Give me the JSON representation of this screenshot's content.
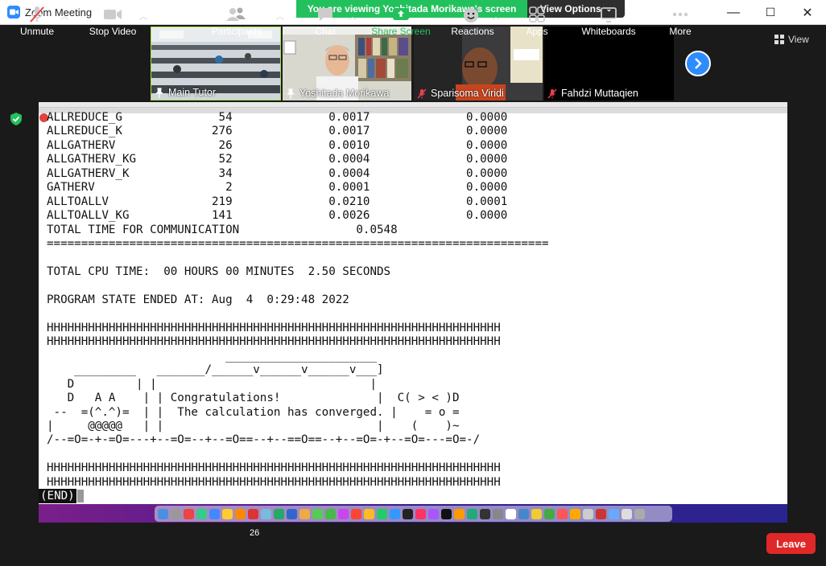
{
  "window": {
    "title": "Zoom Meeting",
    "minimize": "—",
    "maximize": "☐",
    "close": "✕"
  },
  "banner": {
    "text": "You are viewing Yoshitada Morikawa's screen",
    "view_options": "View Options"
  },
  "gallery": {
    "view_label": "View",
    "participants": [
      {
        "name": "Main Tutor"
      },
      {
        "name": "Yoshitada Morikawa"
      },
      {
        "name": "Sparisoma Viridi"
      },
      {
        "name": "Fahdzi Muttaqien"
      }
    ]
  },
  "terminal": {
    "lines": [
      "ALLREDUCE_G              54              0.0017              0.0000",
      "ALLREDUCE_K             276              0.0017              0.0000",
      "ALLGATHERV               26              0.0010              0.0000",
      "ALLGATHERV_KG            52              0.0004              0.0000",
      "ALLGATHERV_K             34              0.0004              0.0000",
      "GATHERV                   2              0.0001              0.0000",
      "ALLTOALLV               219              0.0210              0.0001",
      "ALLTOALLV_KG            141              0.0026              0.0000",
      "TOTAL TIME FOR COMMUNICATION                 0.0548",
      "=========================================================================",
      "",
      "TOTAL CPU TIME:  00 HOURS 00 MINUTES  2.50 SECONDS",
      "",
      "PROGRAM STATE ENDED AT: Aug  4  0:29:48 2022",
      "",
      "HHHHHHHHHHHHHHHHHHHHHHHHHHHHHHHHHHHHHHHHHHHHHHHHHHHHHHHHHHHHHHHHHH",
      "HHHHHHHHHHHHHHHHHHHHHHHHHHHHHHHHHHHHHHHHHHHHHHHHHHHHHHHHHHHHHHHHHH",
      "                          ______________________",
      "    _________   _______/______v______v______v___]",
      "   D         | |                               |",
      "   D   A A    | | Congratulations!              |  C( > < )D",
      " --  =(^.^)=  | |  The calculation has converged. |    = o =",
      "|     @@@@@   | |                               |    (    )~",
      "/--=O=-+-=O=---+--=O=--+--=O==--+--==O==--+--=O=-+--=O=---=O=-/",
      "",
      "HHHHHHHHHHHHHHHHHHHHHHHHHHHHHHHHHHHHHHHHHHHHHHHHHHHHHHHHHHHHHHHHHH",
      "HHHHHHHHHHHHHHHHHHHHHHHHHHHHHHHHHHHHHHHHHHHHHHHHHHHHHHHHHHHHHHHHHH"
    ],
    "end_marker": "(END)"
  },
  "toolbar": {
    "unmute": "Unmute",
    "stop_video": "Stop Video",
    "participants": "Participants",
    "participants_count": "26",
    "chat": "Chat",
    "share_screen": "Share Screen",
    "reactions": "Reactions",
    "apps": "Apps",
    "whiteboards": "Whiteboards",
    "more": "More",
    "leave": "Leave"
  },
  "colors": {
    "accent": "#2d8cff",
    "banner": "#23c15d",
    "leave": "#e02828",
    "share": "#23c15d"
  }
}
